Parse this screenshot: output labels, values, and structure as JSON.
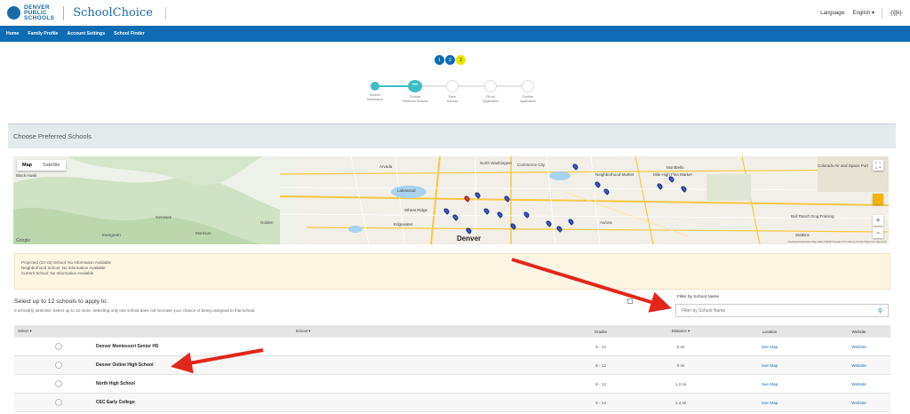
{
  "header": {
    "logo_line1": "DENVER",
    "logo_line2": "PUBLIC",
    "logo_line3": "SCHOOLS",
    "app_title": "SchoolChoice",
    "language_label": "Language:",
    "language_value": "English",
    "user_menu": "‑[i][k]‑"
  },
  "nav": {
    "items": [
      "Home",
      "Family Profile",
      "Account Settings",
      "School Finder"
    ]
  },
  "pager": [
    "1",
    "2",
    "3"
  ],
  "stepper": {
    "steps": [
      {
        "label1": "Student",
        "label2": "Information"
      },
      {
        "label1": "Choose",
        "label2": "Preferred Schools"
      },
      {
        "label1": "Rank",
        "label2": "schools"
      },
      {
        "label1": "Fill out",
        "label2": "Application"
      },
      {
        "label1": "Confirm",
        "label2": "Application"
      }
    ],
    "current_marker": "•••",
    "accent_color": "#3dbfc4"
  },
  "section_title": "Choose Preferred Schools",
  "map": {
    "tab_map": "Map",
    "tab_satellite": "Satellite",
    "places": [
      "Black Hawk",
      "Arvada",
      "Wheat Ridge",
      "Golden",
      "Edgewater",
      "Aurora",
      "Denver",
      "Lakewood",
      "North Washington",
      "Commerce City",
      "Montbello",
      "Genesee",
      "Morrison",
      "Evergreen",
      "Colorado Air and Space Port",
      "Neighborhood Market",
      "Watkins",
      "Mile High Flea Market",
      "Bull Ranch Dog Training"
    ],
    "google": "Google",
    "footer": "Keyboard shortcuts  Map data ©2025 Google  2 km  Terms of Use  Report a map error"
  },
  "info": {
    "projected": "Projected (22-23) School: No Information Available",
    "neighborhood": "Neighborhood School: No Information Available",
    "current": "Current School: No Information Available"
  },
  "selection": {
    "title": "Select up to 12 schools to apply to:",
    "subtitle": "0 school(s) selected. Select up to 12 more. Selecting only one school does not increase your chance of being assigned to that school."
  },
  "filter": {
    "label": "Filter by School Name",
    "placeholder": "Filter by School Name"
  },
  "table": {
    "headers": [
      "Select",
      "School",
      "Grades",
      "Distance",
      "Location",
      "Website"
    ],
    "rows": [
      {
        "school": "Denver Montessori Senior HS",
        "grades": "9 - 12",
        "distance": "0 mi",
        "location": "See Map",
        "website": "Website"
      },
      {
        "school": "Denver Online High School",
        "grades": "9 - 12",
        "distance": "0 mi",
        "location": "See Map",
        "website": "Website"
      },
      {
        "school": "North High School",
        "grades": "9 - 12",
        "distance": "1.2 mi",
        "location": "See Map",
        "website": "Website"
      },
      {
        "school": "CEC Early College",
        "grades": "9 - 12",
        "distance": "1.4 mi",
        "location": "See Map",
        "website": "Website"
      }
    ]
  }
}
